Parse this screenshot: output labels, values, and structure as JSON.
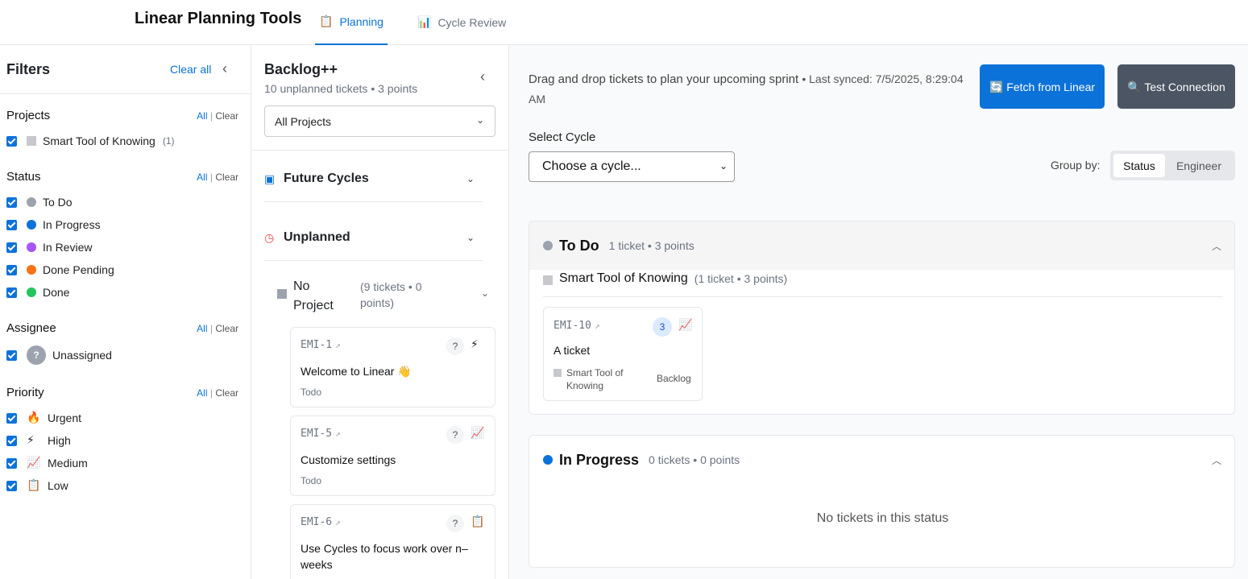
{
  "app": {
    "title": "Linear Planning Tools",
    "tabs": [
      {
        "icon": "📋",
        "label": "Planning",
        "active": true
      },
      {
        "icon": "📊",
        "label": "Cycle Review",
        "active": false
      }
    ]
  },
  "filters": {
    "title": "Filters",
    "clear_all": "Clear all",
    "all_label": "All",
    "sep": "|",
    "clear_label": "Clear",
    "projects": {
      "title": "Projects",
      "items": [
        {
          "label": "Smart Tool of Knowing",
          "count": "(1)"
        }
      ]
    },
    "status": {
      "title": "Status",
      "items": [
        {
          "label": "To Do",
          "color": "#9ca3af"
        },
        {
          "label": "In Progress",
          "color": "#0b72d9"
        },
        {
          "label": "In Review",
          "color": "#a855f7"
        },
        {
          "label": "Done Pending",
          "color": "#f97316"
        },
        {
          "label": "Done",
          "color": "#22c55e"
        }
      ]
    },
    "assignee": {
      "title": "Assignee",
      "items": [
        {
          "avatar": "?",
          "label": "Unassigned"
        }
      ]
    },
    "priority": {
      "title": "Priority",
      "items": [
        {
          "icon": "🔥",
          "label": "Urgent"
        },
        {
          "icon": "⚡",
          "label": "High"
        },
        {
          "icon": "📈",
          "label": "Medium"
        },
        {
          "icon": "📋",
          "label": "Low"
        }
      ]
    }
  },
  "backlog": {
    "title": "Backlog++",
    "subtitle": "10 unplanned tickets • 3 points",
    "project_select": "All Projects",
    "sections": [
      {
        "icon": "📅",
        "label": "Future Cycles"
      },
      {
        "icon": "🕒",
        "label": "Unplanned"
      }
    ],
    "no_project": {
      "label": "No Project",
      "count": "(9 tickets • 0 points)"
    },
    "tickets": [
      {
        "id": "EMI-1",
        "estimate": "?",
        "priority_icon": "⚡",
        "title": "Welcome to Linear 👋",
        "status": "Todo"
      },
      {
        "id": "EMI-5",
        "estimate": "?",
        "priority_icon": "📈",
        "title": "Customize settings",
        "status": "Todo"
      },
      {
        "id": "EMI-6",
        "estimate": "?",
        "priority_icon": "📋",
        "title": "Use Cycles to focus work over n–weeks",
        "status": ""
      }
    ]
  },
  "main": {
    "description": "Drag and drop tickets to plan your upcoming sprint",
    "last_synced": "• Last synced: 7/5/2025, 8:29:04 AM",
    "fetch_button": "🔄 Fetch from Linear",
    "test_button": "🔍 Test Connection",
    "cycle_label": "Select Cycle",
    "cycle_select": "Choose a cycle...",
    "group_by_label": "Group by:",
    "group_by_options": [
      "Status",
      "Engineer"
    ],
    "groups": [
      {
        "name": "To Do",
        "color": "#9ca3af",
        "meta": "1 ticket • 3 points",
        "subgroup": {
          "name": "Smart Tool of Knowing",
          "meta": "(1 ticket • 3 points)"
        },
        "ticket": {
          "id": "EMI-10",
          "estimate": "3",
          "priority_icon": "📈",
          "title": "A ticket",
          "project": "Smart Tool of Knowing",
          "status": "Backlog"
        }
      },
      {
        "name": "In Progress",
        "color": "#0b72d9",
        "meta": "0 tickets • 0 points",
        "empty": "No tickets in this status"
      }
    ]
  }
}
